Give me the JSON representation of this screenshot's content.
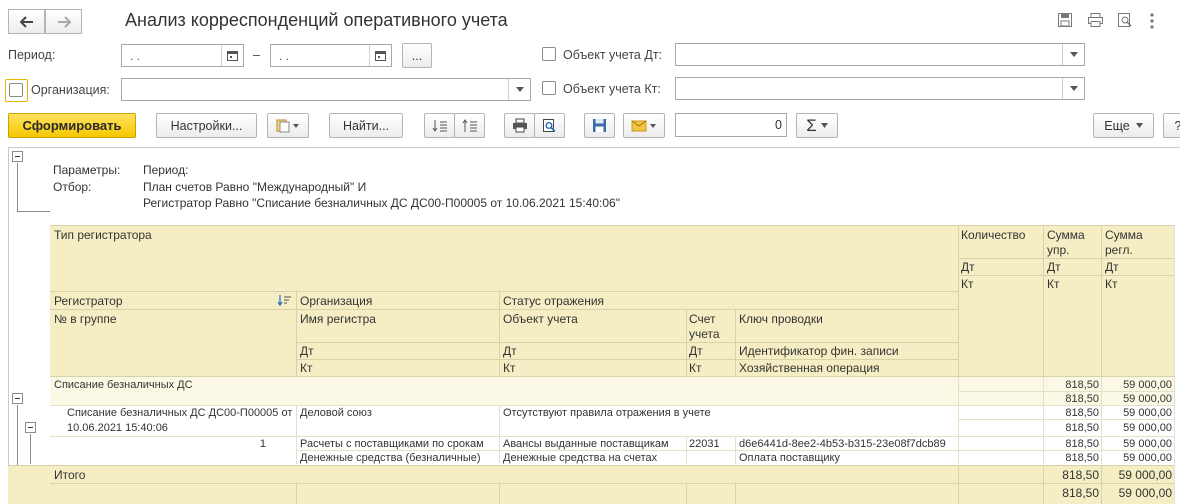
{
  "window": {
    "title": "Анализ корреспонденций оперативного учета"
  },
  "filters": {
    "period_label": "Период:",
    "period_from": " .   .",
    "dash": "–",
    "period_to": " .   .",
    "period_more": "...",
    "org_label": "Организация:",
    "org_value": "",
    "obj_dt_label": "Объект учета Дт:",
    "obj_dt_value": "",
    "obj_kt_label": "Объект учета Кт:",
    "obj_kt_value": ""
  },
  "toolbar": {
    "generate_label": "Сформировать",
    "settings_label": "Настройки...",
    "find_label": "Найти...",
    "sum_value": "0",
    "sigma": "Σ",
    "more_label": "Еще",
    "help_label": "?"
  },
  "report": {
    "params_label": "Параметры:",
    "params_value": "Период:",
    "filter_label": "Отбор:",
    "filter_line1": "План счетов Равно \"Международный\" И",
    "filter_line2": "Регистратор Равно \"Списание безналичных ДС ДС00-П00005 от 10.06.2021 15:40:06\"",
    "headers": {
      "registrar_type": "Тип регистратора",
      "quantity": "Количество",
      "sum_upr_1": "Сумма",
      "sum_upr_2": "упр.",
      "sum_regl_1": "Сумма",
      "sum_regl_2": "регл.",
      "dt": "Дт",
      "kt": "Кт",
      "registrar": "Регистратор",
      "organization": "Организация",
      "status": "Статус отражения",
      "group_no": "№ в группе",
      "register_name": "Имя регистра",
      "account_object": "Объект учета",
      "account_1": "Счет",
      "account_2": "учета",
      "posting_key": "Ключ проводки",
      "fin_record_id": "Идентификатор фин. записи",
      "business_operation": "Хозяйственная операция"
    },
    "group_row": {
      "label": "Списание безналичных ДС",
      "sum_upr_dt": "818,50",
      "sum_regl_dt": "59 000,00",
      "sum_upr_kt": "818,50",
      "sum_regl_kt": "59 000,00"
    },
    "doc_row": {
      "label_1": "Списание безналичных ДС ДС00-П00005 от",
      "label_2": "10.06.2021 15:40:06",
      "organization": "Деловой союз",
      "status": "Отсутствуют правила отражения в учете",
      "sum_upr_dt": "818,50",
      "sum_regl_dt": "59 000,00",
      "sum_upr_kt": "818,50",
      "sum_regl_kt": "59 000,00"
    },
    "detail_row": {
      "group_no": "1",
      "register_dt": "Расчеты с поставщиками по срокам",
      "object_dt": "Авансы выданные поставщикам",
      "account_dt": "22031",
      "fin_id": "d6e6441d-8ee2-4b53-b315-23e08f7dcb89",
      "sum_upr_dt": "818,50",
      "sum_regl_dt": "59 000,00",
      "register_kt": "Денежные средства (безналичные)",
      "object_kt": "Денежные средства на счетах",
      "account_kt": "",
      "operation": "Оплата поставщику",
      "sum_upr_kt": "818,50",
      "sum_regl_kt": "59 000,00"
    },
    "total_row": {
      "label": "Итого",
      "sum_upr_dt": "818,50",
      "sum_regl_dt": "59 000,00",
      "sum_upr_kt": "818,50",
      "sum_regl_kt": "59 000,00"
    }
  },
  "colors": {
    "header_bg": "#f5eec4",
    "group_bg": "#fbf8e6",
    "total_bg": "#f5eec4",
    "primary_btn": "#f6c700"
  }
}
